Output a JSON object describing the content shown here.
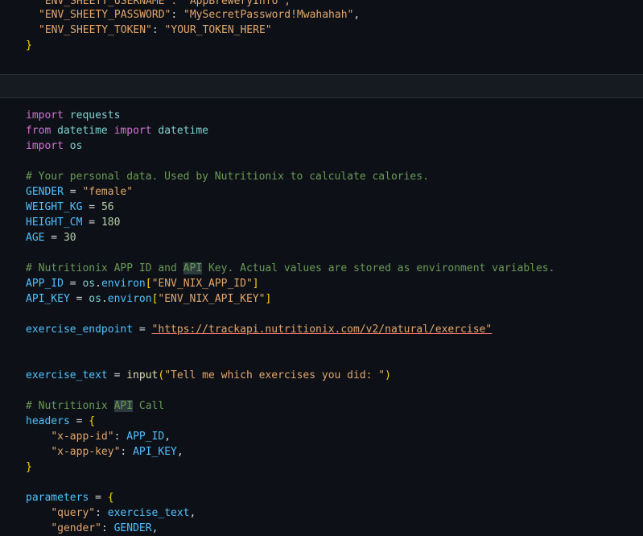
{
  "top_block": {
    "lines": [
      [
        "\"ENV_SHEETY_USERNAME\": \"AppBreweryInfo\","
      ],
      [
        "\"ENV_SHEETY_PASSWORD\"",
        ": ",
        "\"MySecretPassword!Mwahahah\"",
        ","
      ],
      [
        "\"ENV_SHEETY_TOKEN\"",
        ": ",
        "\"YOUR_TOKEN_HERE\""
      ],
      [
        "}"
      ]
    ]
  },
  "code": {
    "l1": [
      "import",
      " ",
      "requests"
    ],
    "l2": [
      "from",
      " ",
      "datetime",
      " ",
      "import",
      " ",
      "datetime"
    ],
    "l3": [
      "import",
      " ",
      "os"
    ],
    "l5": "# Your personal data. Used by Nutritionix to calculate calories.",
    "l6": [
      "GENDER",
      " = ",
      "\"female\""
    ],
    "l7": [
      "WEIGHT_KG",
      " = ",
      "56"
    ],
    "l8": [
      "HEIGHT_CM",
      " = ",
      "180"
    ],
    "l9": [
      "AGE",
      " = ",
      "30"
    ],
    "l11": [
      "# Nutritionix APP ID and ",
      "API",
      " Key. Actual values are stored as environment variables."
    ],
    "l12": [
      "APP_ID",
      " = ",
      "os",
      ".",
      "environ",
      "[",
      "\"ENV_NIX_APP_ID\"",
      "]"
    ],
    "l13": [
      "API_KEY",
      " = ",
      "os",
      ".",
      "environ",
      "[",
      "\"ENV_NIX_API_KEY\"",
      "]"
    ],
    "l15": [
      "exercise_endpoint",
      " = ",
      "\"",
      "https://trackapi.nutritionix.com/v2/natural/exercise",
      "\""
    ],
    "l18": [
      "exercise_text",
      " = ",
      "input",
      "(",
      "\"Tell me which exercises you did: \"",
      ")"
    ],
    "l20": [
      "# Nutritionix ",
      "API",
      " Call"
    ],
    "l21": [
      "headers",
      " = ",
      "{"
    ],
    "l22": [
      "    ",
      "\"x-app-id\"",
      ": ",
      "APP_ID",
      ","
    ],
    "l23": [
      "    ",
      "\"x-app-key\"",
      ": ",
      "API_KEY",
      ","
    ],
    "l24": [
      "}"
    ],
    "l26": [
      "parameters",
      " = ",
      "{"
    ],
    "l27": [
      "    ",
      "\"query\"",
      ": ",
      "exercise_text",
      ","
    ],
    "l28": [
      "    ",
      "\"gender\"",
      ": ",
      "GENDER",
      ","
    ]
  }
}
